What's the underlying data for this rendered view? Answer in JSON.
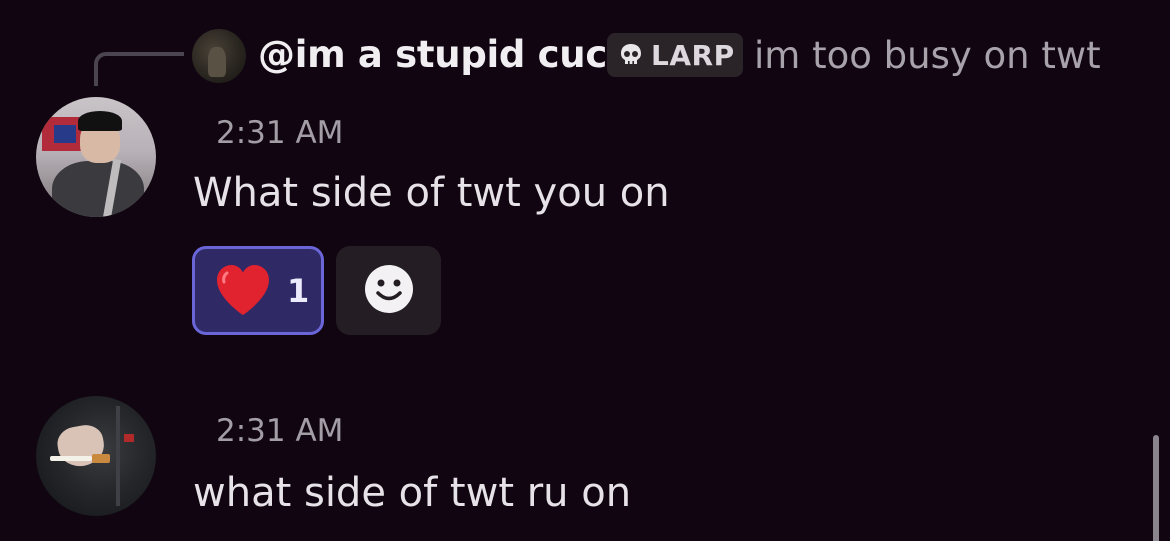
{
  "reply": {
    "author": "@im a stupid cuck",
    "role_icon": "skull-icon",
    "role_label": "LARP",
    "text": "im too busy on twt"
  },
  "messages": [
    {
      "timestamp": "2:31 AM",
      "text": "What side of twt you on",
      "reactions": [
        {
          "emoji": "red-heart-icon",
          "count": "1"
        }
      ],
      "add_reaction_icon": "smiley-add-reaction-icon"
    },
    {
      "timestamp": "2:31 AM",
      "text": "what side of twt ru on"
    }
  ],
  "colors": {
    "background": "#100510",
    "reaction_bg": "#2f2966",
    "reaction_border": "#6a66d8",
    "add_reaction_bg": "#241d24"
  }
}
